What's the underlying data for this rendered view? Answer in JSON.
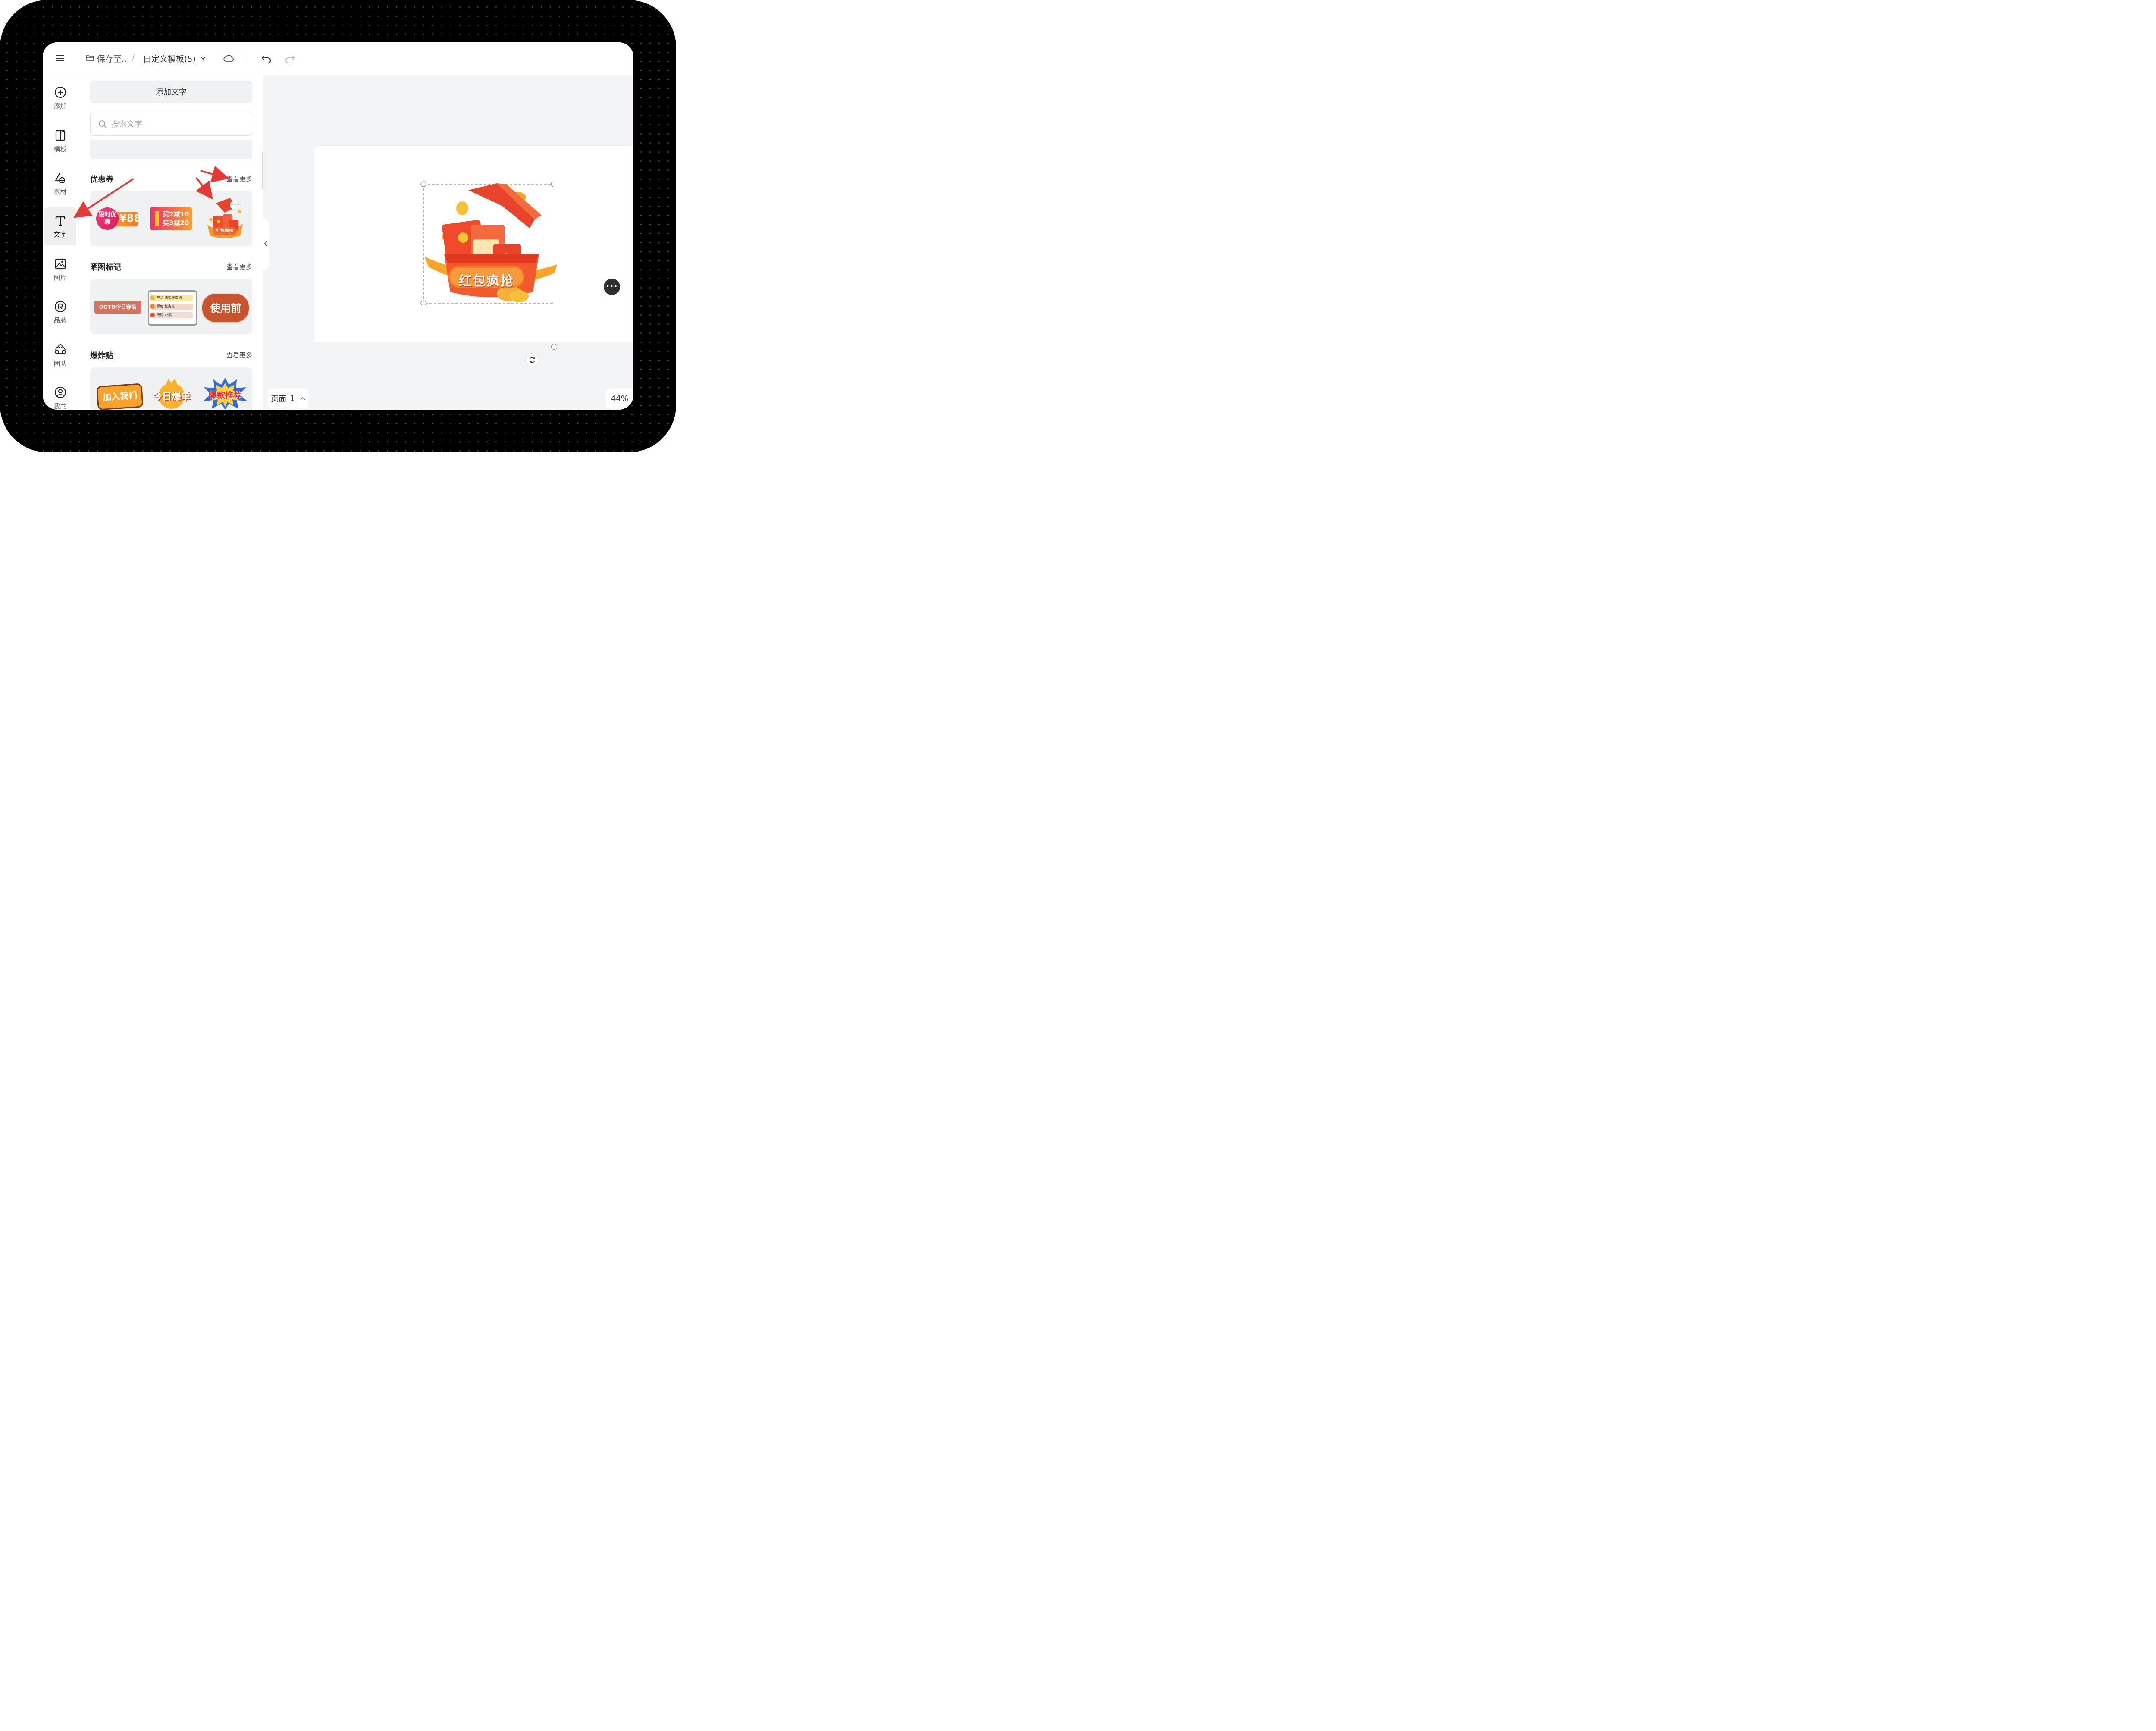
{
  "topbar": {
    "save_label": "保存至...",
    "separator": "/",
    "doc_title": "自定义模板(5)"
  },
  "rail": {
    "items": [
      {
        "label": "添加",
        "icon": "plus-circle-icon"
      },
      {
        "label": "模板",
        "icon": "template-icon"
      },
      {
        "label": "素材",
        "icon": "shapes-icon"
      },
      {
        "label": "文字",
        "icon": "text-icon"
      },
      {
        "label": "图片",
        "icon": "image-icon"
      },
      {
        "label": "品牌",
        "icon": "brand-icon"
      },
      {
        "label": "团队",
        "icon": "team-icon"
      },
      {
        "label": "我的",
        "icon": "user-icon"
      }
    ],
    "active": "文字"
  },
  "panel": {
    "add_text_label": "添加文字",
    "search_placeholder": "搜索文字",
    "sections": [
      {
        "title": "优惠券",
        "see_more": "查看更多"
      },
      {
        "title": "晒图标记",
        "see_more": "查看更多"
      },
      {
        "title": "爆炸贴",
        "see_more": "查看更多"
      }
    ],
    "coupon_stickers": {
      "s1_left": "限时优惠",
      "s1_price": "¥88",
      "s2_line1": "买2减10",
      "s2_line2": "买3减20",
      "s3_label": "红包疯抢"
    },
    "mark_stickers": {
      "s1": "OOTD今日穿搭",
      "s2_rows": [
        "产品 法式连衣裙",
        "颜色 复古红",
        "尺码 XS码"
      ],
      "s3": "使用前"
    },
    "burst_stickers": {
      "s1": "加入我们",
      "s2": "今日爆单",
      "s3": "爆款推荐"
    }
  },
  "canvas": {
    "selected_sticker_text": "红包疯抢",
    "page_label": "页面",
    "page_number": "1",
    "zoom": "44%"
  },
  "colors": {
    "annotation_arrow": "#e53935",
    "accent_red": "#f0472b",
    "accent_orange": "#f9a12e"
  }
}
